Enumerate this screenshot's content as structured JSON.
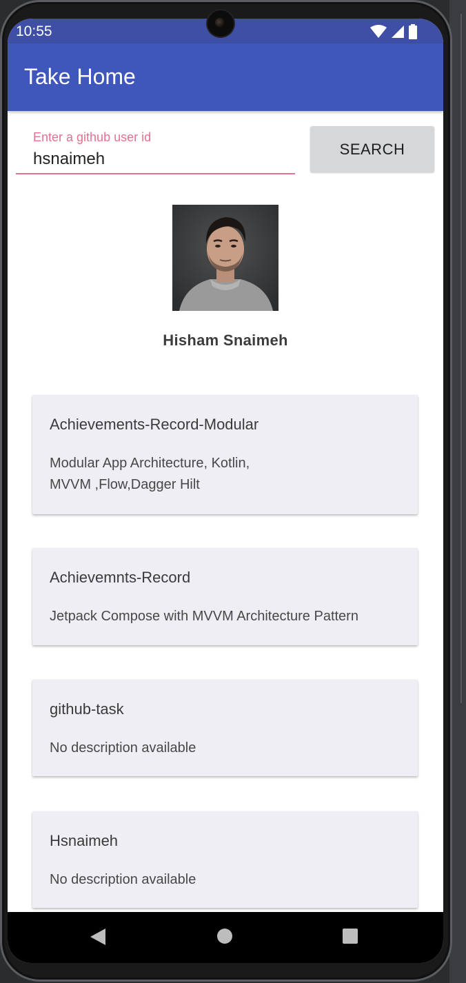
{
  "status_bar": {
    "time": "10:55",
    "icons": [
      "wifi-icon",
      "cell-signal-icon",
      "battery-icon"
    ]
  },
  "app_bar": {
    "title": "Take Home"
  },
  "search": {
    "label": "Enter a github user id",
    "value": "hsnaimeh",
    "button_label": "SEARCH"
  },
  "profile": {
    "name": "Hisham Snaimeh"
  },
  "repos": [
    {
      "title": "Achievements-Record-Modular",
      "description_lines": [
        "Modular App Architecture, Kotlin,",
        "MVVM ,Flow,Dagger Hilt"
      ]
    },
    {
      "title": "Achievemnts-Record",
      "description_lines": [
        "Jetpack Compose with MVVM Architecture Pattern"
      ]
    },
    {
      "title": "github-task",
      "description_lines": [
        "No description available"
      ]
    },
    {
      "title": "Hsnaimeh",
      "description_lines": [
        "No description available"
      ]
    }
  ],
  "nav_bar": {
    "buttons": [
      "back-icon",
      "home-icon",
      "recents-icon"
    ]
  },
  "colors": {
    "primary": "#3f57bb",
    "status_bar": "#3f4fa6",
    "accent": "#e5708f",
    "card_bg": "#efeef4",
    "button_bg": "#d6d7d9"
  }
}
